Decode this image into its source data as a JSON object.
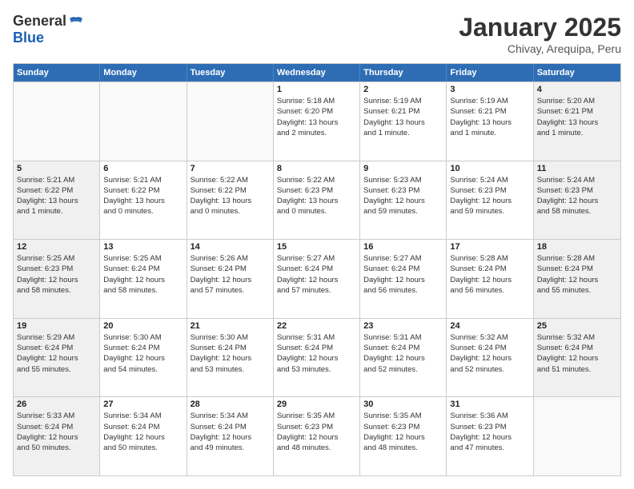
{
  "header": {
    "logo_general": "General",
    "logo_blue": "Blue",
    "title": "January 2025",
    "subtitle": "Chivay, Arequipa, Peru"
  },
  "weekdays": [
    "Sunday",
    "Monday",
    "Tuesday",
    "Wednesday",
    "Thursday",
    "Friday",
    "Saturday"
  ],
  "weeks": [
    [
      {
        "day": "",
        "info": "",
        "empty": true
      },
      {
        "day": "",
        "info": "",
        "empty": true
      },
      {
        "day": "",
        "info": "",
        "empty": true
      },
      {
        "day": "1",
        "info": "Sunrise: 5:18 AM\nSunset: 6:20 PM\nDaylight: 13 hours\nand 2 minutes."
      },
      {
        "day": "2",
        "info": "Sunrise: 5:19 AM\nSunset: 6:21 PM\nDaylight: 13 hours\nand 1 minute."
      },
      {
        "day": "3",
        "info": "Sunrise: 5:19 AM\nSunset: 6:21 PM\nDaylight: 13 hours\nand 1 minute."
      },
      {
        "day": "4",
        "info": "Sunrise: 5:20 AM\nSunset: 6:21 PM\nDaylight: 13 hours\nand 1 minute."
      }
    ],
    [
      {
        "day": "5",
        "info": "Sunrise: 5:21 AM\nSunset: 6:22 PM\nDaylight: 13 hours\nand 1 minute."
      },
      {
        "day": "6",
        "info": "Sunrise: 5:21 AM\nSunset: 6:22 PM\nDaylight: 13 hours\nand 0 minutes."
      },
      {
        "day": "7",
        "info": "Sunrise: 5:22 AM\nSunset: 6:22 PM\nDaylight: 13 hours\nand 0 minutes."
      },
      {
        "day": "8",
        "info": "Sunrise: 5:22 AM\nSunset: 6:23 PM\nDaylight: 13 hours\nand 0 minutes."
      },
      {
        "day": "9",
        "info": "Sunrise: 5:23 AM\nSunset: 6:23 PM\nDaylight: 12 hours\nand 59 minutes."
      },
      {
        "day": "10",
        "info": "Sunrise: 5:24 AM\nSunset: 6:23 PM\nDaylight: 12 hours\nand 59 minutes."
      },
      {
        "day": "11",
        "info": "Sunrise: 5:24 AM\nSunset: 6:23 PM\nDaylight: 12 hours\nand 58 minutes."
      }
    ],
    [
      {
        "day": "12",
        "info": "Sunrise: 5:25 AM\nSunset: 6:23 PM\nDaylight: 12 hours\nand 58 minutes."
      },
      {
        "day": "13",
        "info": "Sunrise: 5:25 AM\nSunset: 6:24 PM\nDaylight: 12 hours\nand 58 minutes."
      },
      {
        "day": "14",
        "info": "Sunrise: 5:26 AM\nSunset: 6:24 PM\nDaylight: 12 hours\nand 57 minutes."
      },
      {
        "day": "15",
        "info": "Sunrise: 5:27 AM\nSunset: 6:24 PM\nDaylight: 12 hours\nand 57 minutes."
      },
      {
        "day": "16",
        "info": "Sunrise: 5:27 AM\nSunset: 6:24 PM\nDaylight: 12 hours\nand 56 minutes."
      },
      {
        "day": "17",
        "info": "Sunrise: 5:28 AM\nSunset: 6:24 PM\nDaylight: 12 hours\nand 56 minutes."
      },
      {
        "day": "18",
        "info": "Sunrise: 5:28 AM\nSunset: 6:24 PM\nDaylight: 12 hours\nand 55 minutes."
      }
    ],
    [
      {
        "day": "19",
        "info": "Sunrise: 5:29 AM\nSunset: 6:24 PM\nDaylight: 12 hours\nand 55 minutes."
      },
      {
        "day": "20",
        "info": "Sunrise: 5:30 AM\nSunset: 6:24 PM\nDaylight: 12 hours\nand 54 minutes."
      },
      {
        "day": "21",
        "info": "Sunrise: 5:30 AM\nSunset: 6:24 PM\nDaylight: 12 hours\nand 53 minutes."
      },
      {
        "day": "22",
        "info": "Sunrise: 5:31 AM\nSunset: 6:24 PM\nDaylight: 12 hours\nand 53 minutes."
      },
      {
        "day": "23",
        "info": "Sunrise: 5:31 AM\nSunset: 6:24 PM\nDaylight: 12 hours\nand 52 minutes."
      },
      {
        "day": "24",
        "info": "Sunrise: 5:32 AM\nSunset: 6:24 PM\nDaylight: 12 hours\nand 52 minutes."
      },
      {
        "day": "25",
        "info": "Sunrise: 5:32 AM\nSunset: 6:24 PM\nDaylight: 12 hours\nand 51 minutes."
      }
    ],
    [
      {
        "day": "26",
        "info": "Sunrise: 5:33 AM\nSunset: 6:24 PM\nDaylight: 12 hours\nand 50 minutes."
      },
      {
        "day": "27",
        "info": "Sunrise: 5:34 AM\nSunset: 6:24 PM\nDaylight: 12 hours\nand 50 minutes."
      },
      {
        "day": "28",
        "info": "Sunrise: 5:34 AM\nSunset: 6:24 PM\nDaylight: 12 hours\nand 49 minutes."
      },
      {
        "day": "29",
        "info": "Sunrise: 5:35 AM\nSunset: 6:23 PM\nDaylight: 12 hours\nand 48 minutes."
      },
      {
        "day": "30",
        "info": "Sunrise: 5:35 AM\nSunset: 6:23 PM\nDaylight: 12 hours\nand 48 minutes."
      },
      {
        "day": "31",
        "info": "Sunrise: 5:36 AM\nSunset: 6:23 PM\nDaylight: 12 hours\nand 47 minutes."
      },
      {
        "day": "",
        "info": "",
        "empty": true
      }
    ]
  ]
}
